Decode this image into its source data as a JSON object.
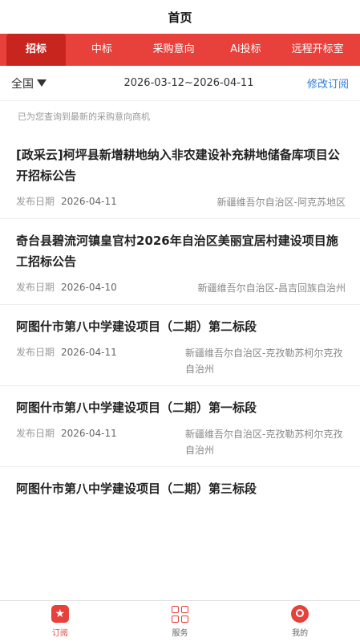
{
  "header": {
    "title": "首页"
  },
  "tabs": [
    {
      "label": "招标"
    },
    {
      "label": "中标"
    },
    {
      "label": "采购意向"
    },
    {
      "label": "Ai投标"
    },
    {
      "label": "远程开标室"
    }
  ],
  "filter": {
    "region": "全国",
    "date_range": "2026-03-12~2026-04-11",
    "modify_label": "修改订阅"
  },
  "hint": "已为您查询到最新的采购意向商机",
  "items": [
    {
      "title": "[政采云]柯坪县新增耕地纳入非农建设补充耕地储备库项目公开招标公告",
      "pub_label": "发布日期",
      "date": "2026-04-11",
      "location": "新疆维吾尔自治区-阿克苏地区"
    },
    {
      "title": "奇台县碧流河镇皇官村2026年自治区美丽宜居村建设项目施工招标公告",
      "pub_label": "发布日期",
      "date": "2026-04-10",
      "location": "新疆维吾尔自治区-昌吉回族自治州"
    },
    {
      "title": "阿图什市第八中学建设项目（二期）第二标段",
      "pub_label": "发布日期",
      "date": "2026-04-11",
      "location": "新疆维吾尔自治区-克孜勒苏柯尔克孜自治州"
    },
    {
      "title": "阿图什市第八中学建设项目（二期）第一标段",
      "pub_label": "发布日期",
      "date": "2026-04-11",
      "location": "新疆维吾尔自治区-克孜勒苏柯尔克孜自治州"
    },
    {
      "title": "阿图什市第八中学建设项目（二期）第三标段",
      "pub_label": "",
      "date": "",
      "location": ""
    }
  ],
  "bottom_nav": [
    {
      "label": "订阅",
      "icon": "star-icon"
    },
    {
      "label": "服务",
      "icon": "grid-icon"
    },
    {
      "label": "我的",
      "icon": "user-icon"
    }
  ]
}
